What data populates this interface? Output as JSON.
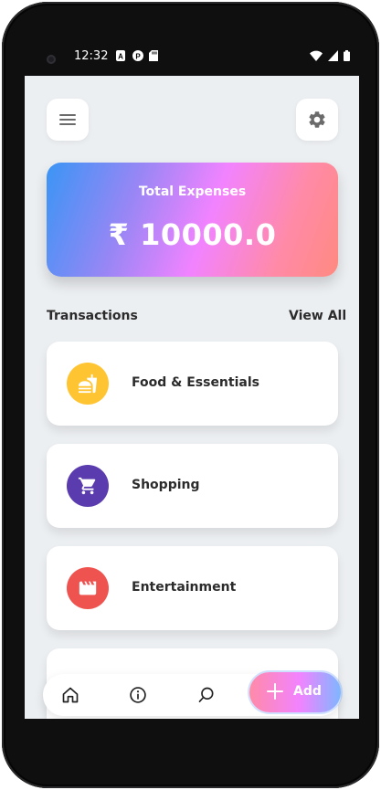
{
  "status_bar": {
    "time": "12:32"
  },
  "header": {
    "menu_icon": "menu-icon",
    "settings_icon": "gear-icon"
  },
  "summary": {
    "label": "Total Expenses",
    "amount": "₹ 10000.0"
  },
  "transactions": {
    "title": "Transactions",
    "view_all": "View All",
    "items": [
      {
        "label": "Food & Essentials",
        "icon": "fastfood-icon",
        "color": "#FFC431"
      },
      {
        "label": "Shopping",
        "icon": "cart-icon",
        "color": "#5A3CAE"
      },
      {
        "label": "Entertainment",
        "icon": "clapperboard-icon",
        "color": "#EF5350"
      }
    ]
  },
  "bottom_nav": {
    "items": [
      "home-icon",
      "info-icon",
      "search-icon"
    ],
    "add_label": "Add"
  },
  "colors": {
    "background": "#ECEFF2",
    "text": "#2B2B2B",
    "card": "#FFFFFF"
  }
}
